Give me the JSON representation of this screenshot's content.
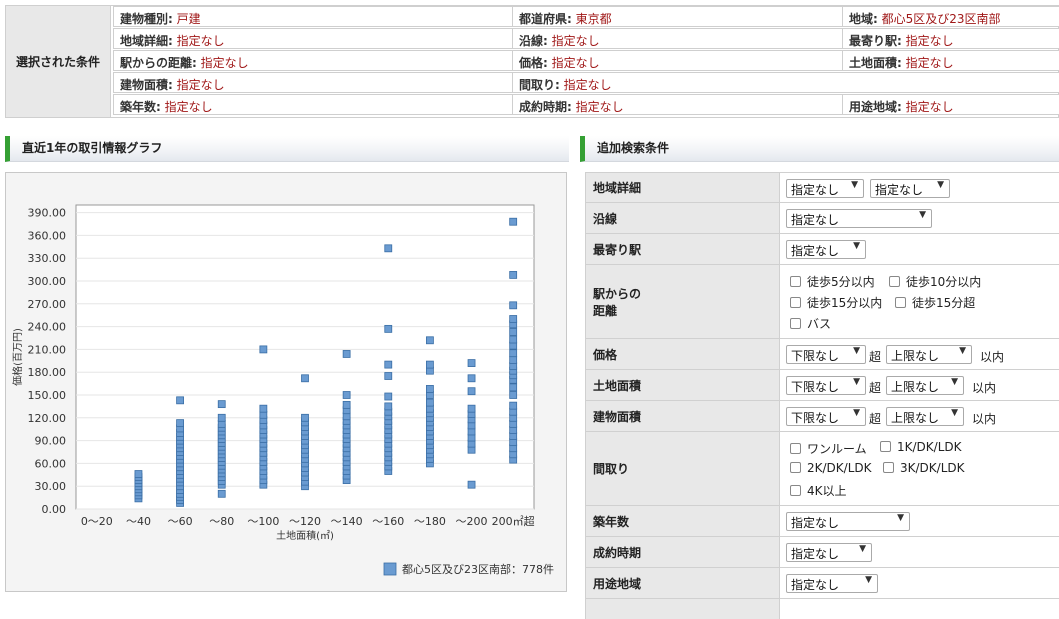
{
  "conditions": {
    "header": "選択された条件",
    "rows": [
      [
        {
          "key": "建物種別:",
          "value": "戸建"
        },
        {
          "key": "都道府県:",
          "value": "東京都"
        },
        {
          "key": "地域:",
          "value": "都心5区及び23区南部"
        }
      ],
      [
        {
          "key": "地域詳細:",
          "value": "指定なし"
        },
        {
          "key": "沿線:",
          "value": "指定なし"
        },
        {
          "key": "最寄り駅:",
          "value": "指定なし"
        }
      ],
      [
        {
          "key": "駅からの距離:",
          "value": "指定なし"
        },
        {
          "key": "価格:",
          "value": "指定なし"
        },
        {
          "key": "土地面積:",
          "value": "指定なし"
        }
      ],
      [
        {
          "key": "建物面積:",
          "value": "指定なし"
        },
        {
          "key": "間取り:",
          "value": "指定なし"
        }
      ],
      [
        {
          "key": "築年数:",
          "value": "指定なし"
        },
        {
          "key": "成約時期:",
          "value": "指定なし"
        },
        {
          "key": "用途地域:",
          "value": "指定なし"
        }
      ]
    ]
  },
  "graph_section": {
    "title": "直近1年の取引情報グラフ"
  },
  "search_section": {
    "title": "追加検索条件"
  },
  "chart_data": {
    "type": "scatter",
    "xlabel": "土地面積(㎡)",
    "ylabel": "価格(百万円)",
    "categories": [
      "0～20",
      "～40",
      "～60",
      "～80",
      "～100",
      "～120",
      "～140",
      "～160",
      "～180",
      "～200",
      "200㎡超"
    ],
    "ylim": [
      0,
      400
    ],
    "yticks": [
      "0.00",
      "30.00",
      "60.00",
      "90.00",
      "120.00",
      "150.00",
      "180.00",
      "210.00",
      "240.00",
      "270.00",
      "300.00",
      "330.00",
      "360.00",
      "390.00"
    ],
    "grid": "horizontal",
    "legend": {
      "label": "都心5区及び23区南部：778件",
      "position": "bottom-right",
      "color": "#6a9bd1"
    },
    "series": [
      {
        "name": "都心5区及び23区南部",
        "points": [
          [
            1,
            14
          ],
          [
            1,
            18
          ],
          [
            1,
            22
          ],
          [
            1,
            26
          ],
          [
            1,
            30
          ],
          [
            1,
            34
          ],
          [
            1,
            38
          ],
          [
            1,
            42
          ],
          [
            1,
            46
          ],
          [
            2,
            8
          ],
          [
            2,
            12
          ],
          [
            2,
            16
          ],
          [
            2,
            20
          ],
          [
            2,
            25
          ],
          [
            2,
            30
          ],
          [
            2,
            35
          ],
          [
            2,
            40
          ],
          [
            2,
            45
          ],
          [
            2,
            50
          ],
          [
            2,
            55
          ],
          [
            2,
            60
          ],
          [
            2,
            65
          ],
          [
            2,
            70
          ],
          [
            2,
            75
          ],
          [
            2,
            80
          ],
          [
            2,
            85
          ],
          [
            2,
            90
          ],
          [
            2,
            95
          ],
          [
            2,
            100
          ],
          [
            2,
            106
          ],
          [
            2,
            113
          ],
          [
            2,
            143
          ],
          [
            3,
            20
          ],
          [
            3,
            32
          ],
          [
            3,
            37
          ],
          [
            3,
            42
          ],
          [
            3,
            47
          ],
          [
            3,
            52
          ],
          [
            3,
            57
          ],
          [
            3,
            62
          ],
          [
            3,
            67
          ],
          [
            3,
            72
          ],
          [
            3,
            77
          ],
          [
            3,
            82
          ],
          [
            3,
            87
          ],
          [
            3,
            92
          ],
          [
            3,
            97
          ],
          [
            3,
            102
          ],
          [
            3,
            107
          ],
          [
            3,
            112
          ],
          [
            3,
            120
          ],
          [
            3,
            138
          ],
          [
            4,
            32
          ],
          [
            4,
            38
          ],
          [
            4,
            44
          ],
          [
            4,
            50
          ],
          [
            4,
            56
          ],
          [
            4,
            62
          ],
          [
            4,
            68
          ],
          [
            4,
            74
          ],
          [
            4,
            80
          ],
          [
            4,
            86
          ],
          [
            4,
            92
          ],
          [
            4,
            98
          ],
          [
            4,
            104
          ],
          [
            4,
            110
          ],
          [
            4,
            117
          ],
          [
            4,
            124
          ],
          [
            4,
            132
          ],
          [
            4,
            210
          ],
          [
            5,
            30
          ],
          [
            5,
            36
          ],
          [
            5,
            42
          ],
          [
            5,
            48
          ],
          [
            5,
            54
          ],
          [
            5,
            60
          ],
          [
            5,
            66
          ],
          [
            5,
            72
          ],
          [
            5,
            78
          ],
          [
            5,
            84
          ],
          [
            5,
            90
          ],
          [
            5,
            96
          ],
          [
            5,
            102
          ],
          [
            5,
            108
          ],
          [
            5,
            114
          ],
          [
            5,
            120
          ],
          [
            5,
            172
          ],
          [
            6,
            38
          ],
          [
            6,
            44
          ],
          [
            6,
            50
          ],
          [
            6,
            56
          ],
          [
            6,
            62
          ],
          [
            6,
            68
          ],
          [
            6,
            74
          ],
          [
            6,
            80
          ],
          [
            6,
            86
          ],
          [
            6,
            92
          ],
          [
            6,
            98
          ],
          [
            6,
            104
          ],
          [
            6,
            110
          ],
          [
            6,
            116
          ],
          [
            6,
            122
          ],
          [
            6,
            130
          ],
          [
            6,
            137
          ],
          [
            6,
            150
          ],
          [
            6,
            204
          ],
          [
            7,
            50
          ],
          [
            7,
            56
          ],
          [
            7,
            62
          ],
          [
            7,
            68
          ],
          [
            7,
            74
          ],
          [
            7,
            80
          ],
          [
            7,
            86
          ],
          [
            7,
            92
          ],
          [
            7,
            98
          ],
          [
            7,
            104
          ],
          [
            7,
            110
          ],
          [
            7,
            116
          ],
          [
            7,
            122
          ],
          [
            7,
            128
          ],
          [
            7,
            135
          ],
          [
            7,
            148
          ],
          [
            7,
            175
          ],
          [
            7,
            190
          ],
          [
            7,
            237
          ],
          [
            7,
            343
          ],
          [
            8,
            60
          ],
          [
            8,
            66
          ],
          [
            8,
            72
          ],
          [
            8,
            78
          ],
          [
            8,
            84
          ],
          [
            8,
            90
          ],
          [
            8,
            96
          ],
          [
            8,
            102
          ],
          [
            8,
            108
          ],
          [
            8,
            114
          ],
          [
            8,
            120
          ],
          [
            8,
            126
          ],
          [
            8,
            132
          ],
          [
            8,
            140
          ],
          [
            8,
            150
          ],
          [
            8,
            158
          ],
          [
            8,
            182
          ],
          [
            8,
            190
          ],
          [
            8,
            222
          ],
          [
            9,
            32
          ],
          [
            9,
            78
          ],
          [
            9,
            86
          ],
          [
            9,
            94
          ],
          [
            9,
            102
          ],
          [
            9,
            110
          ],
          [
            9,
            118
          ],
          [
            9,
            125
          ],
          [
            9,
            132
          ],
          [
            9,
            155
          ],
          [
            9,
            172
          ],
          [
            9,
            192
          ],
          [
            10,
            65
          ],
          [
            10,
            72
          ],
          [
            10,
            80
          ],
          [
            10,
            88
          ],
          [
            10,
            96
          ],
          [
            10,
            104
          ],
          [
            10,
            112
          ],
          [
            10,
            120
          ],
          [
            10,
            128
          ],
          [
            10,
            136
          ],
          [
            10,
            150
          ],
          [
            10,
            160
          ],
          [
            10,
            170
          ],
          [
            10,
            176
          ],
          [
            10,
            182
          ],
          [
            10,
            188
          ],
          [
            10,
            196
          ],
          [
            10,
            205
          ],
          [
            10,
            215
          ],
          [
            10,
            223
          ],
          [
            10,
            233
          ],
          [
            10,
            243
          ],
          [
            10,
            250
          ],
          [
            10,
            268
          ],
          [
            10,
            308
          ],
          [
            10,
            378
          ]
        ]
      }
    ]
  },
  "form": {
    "rows": [
      {
        "label": "地域詳細",
        "selects": [
          "指定なし",
          "指定なし"
        ]
      },
      {
        "label": "沿線",
        "selects": [
          "指定なし"
        ]
      },
      {
        "label": "最寄り駅",
        "selects": [
          "指定なし"
        ]
      },
      {
        "label": "駅からの\n距離",
        "checkboxes": [
          "徒歩5分以内",
          "徒歩10分以内",
          "徒歩15分以内",
          "徒歩15分超",
          "バス"
        ]
      },
      {
        "label": "価格",
        "selects": [
          "下限なし",
          "上限なし"
        ],
        "sep": "超",
        "suffix": "以内"
      },
      {
        "label": "土地面積",
        "selects": [
          "下限なし",
          "上限なし"
        ],
        "sep": "超",
        "suffix": "以内"
      },
      {
        "label": "建物面積",
        "selects": [
          "下限なし",
          "上限なし"
        ],
        "sep": "超",
        "suffix": "以内"
      },
      {
        "label": "間取り",
        "checkboxes": [
          "ワンルーム",
          "1K/DK/LDK",
          "2K/DK/LDK",
          "3K/DK/LDK",
          "4K以上"
        ]
      },
      {
        "label": "築年数",
        "selects": [
          "指定なし"
        ]
      },
      {
        "label": "成約時期",
        "selects": [
          "指定なし"
        ]
      },
      {
        "label": "用途地域",
        "selects": [
          "指定なし"
        ]
      }
    ]
  }
}
